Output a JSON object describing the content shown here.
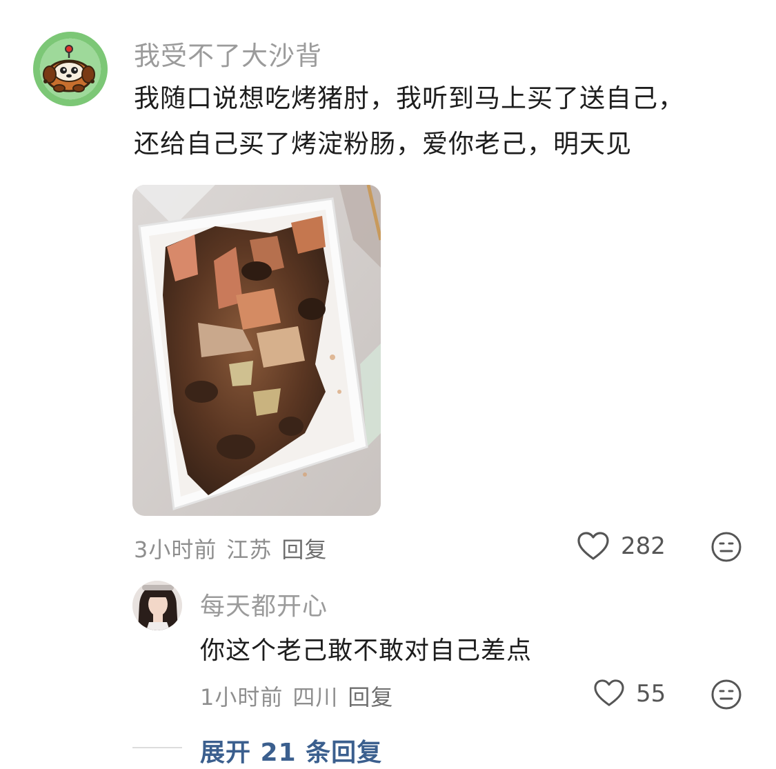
{
  "comment": {
    "username": "我受不了大沙背",
    "text_line1": "我随口说想吃烤猪肘，我听到马上买了送自己，",
    "text_line2": "还给自己买了烤淀粉肠，爱你老己，明天见",
    "image_icon": "food-photo",
    "time": "3小时前",
    "location": "江苏",
    "reply_label": "回复",
    "likes": "282",
    "like_icon": "heart-outline-icon",
    "react_icon": "emoji-face-icon"
  },
  "reply": {
    "username": "每天都开心",
    "text": "你这个老己敢不敢对自己差点",
    "time": "1小时前",
    "location": "四川",
    "reply_label": "回复",
    "likes": "55"
  },
  "expand_label": "展开 21 条回复",
  "colors": {
    "accent": "#3b5f8e",
    "meta": "#8e8e8e",
    "avatar_bg": "#8fd18c"
  }
}
